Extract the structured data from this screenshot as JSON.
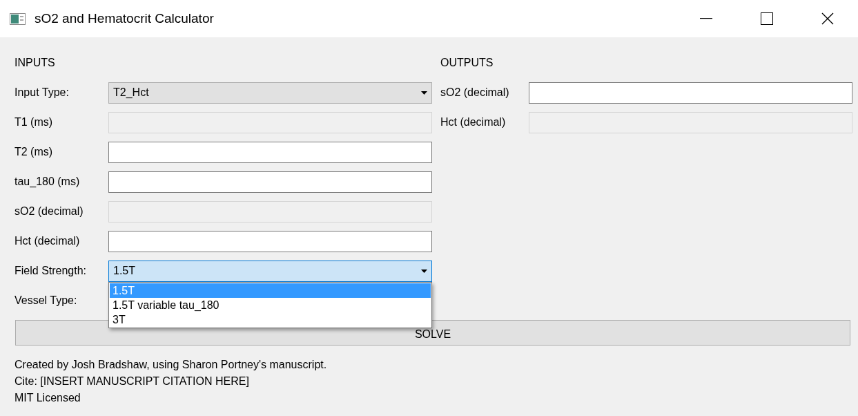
{
  "window": {
    "title": "sO2 and Hematocrit Calculator"
  },
  "inputs": {
    "heading": "INPUTS",
    "rows": [
      {
        "label": "Input Type:",
        "kind": "combo",
        "value": "T2_Hct",
        "open": false
      },
      {
        "label": "T1 (ms)",
        "kind": "text",
        "disabled": true
      },
      {
        "label": "T2 (ms)",
        "kind": "text",
        "disabled": false
      },
      {
        "label": "tau_180 (ms)",
        "kind": "text",
        "disabled": false
      },
      {
        "label": "sO2 (decimal)",
        "kind": "text",
        "disabled": true
      },
      {
        "label": "Hct (decimal)",
        "kind": "text",
        "disabled": false
      },
      {
        "label": "Field Strength:",
        "kind": "combo",
        "value": "1.5T",
        "open": true,
        "options": [
          {
            "label": "1.5T",
            "selected": true
          },
          {
            "label": "1.5T variable tau_180",
            "selected": false
          },
          {
            "label": "3T",
            "selected": false
          }
        ]
      },
      {
        "label": "Vessel Type:",
        "kind": "hidden"
      }
    ]
  },
  "outputs": {
    "heading": "OUTPUTS",
    "rows": [
      {
        "label": "sO2 (decimal)",
        "kind": "text",
        "disabled": false
      },
      {
        "label": "Hct (decimal)",
        "kind": "text",
        "disabled": true
      }
    ]
  },
  "solve_button": "SOLVE",
  "footer": [
    "Created by Josh Bradshaw, using Sharon Portney's manuscript.",
    "Cite: [INSERT MANUSCRIPT CITATION HERE]",
    "MIT Licensed"
  ]
}
